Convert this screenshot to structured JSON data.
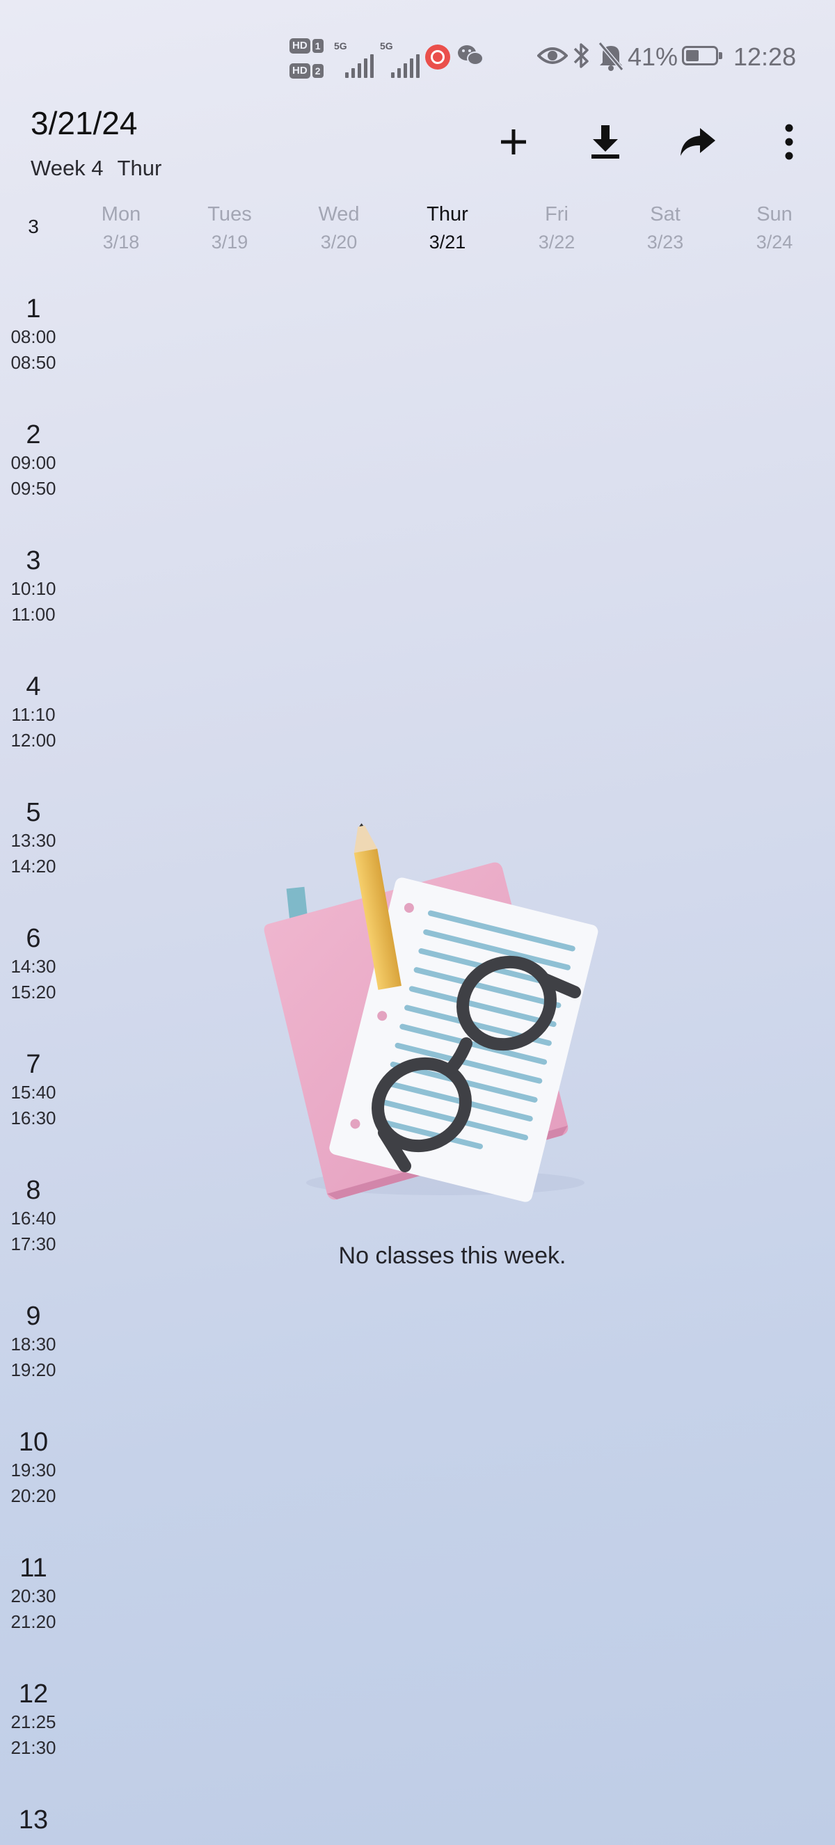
{
  "status_bar": {
    "sim1": {
      "hd": "HD",
      "num": "1"
    },
    "sim2": {
      "hd": "HD",
      "num": "2"
    },
    "net1": "5G",
    "net2": "5G",
    "battery_percent": "41%",
    "time": "12:28",
    "icons": [
      "eye-icon",
      "bluetooth-icon",
      "mute-bell-icon",
      "battery-icon",
      "app-notification-icon",
      "wechat-icon"
    ]
  },
  "header": {
    "date": "3/21/24",
    "week": "Week 4",
    "weekday": "Thur",
    "actions": [
      "add-icon",
      "download-icon",
      "share-icon",
      "more-icon"
    ]
  },
  "week_grid": {
    "month": "3",
    "days": [
      {
        "name": "Mon",
        "date": "3/18",
        "today": false
      },
      {
        "name": "Tues",
        "date": "3/19",
        "today": false
      },
      {
        "name": "Wed",
        "date": "3/20",
        "today": false
      },
      {
        "name": "Thur",
        "date": "3/21",
        "today": true
      },
      {
        "name": "Fri",
        "date": "3/22",
        "today": false
      },
      {
        "name": "Sat",
        "date": "3/23",
        "today": false
      },
      {
        "name": "Sun",
        "date": "3/24",
        "today": false
      }
    ],
    "periods": [
      {
        "num": "1",
        "start": "08:00",
        "end": "08:50"
      },
      {
        "num": "2",
        "start": "09:00",
        "end": "09:50"
      },
      {
        "num": "3",
        "start": "10:10",
        "end": "11:00"
      },
      {
        "num": "4",
        "start": "11:10",
        "end": "12:00"
      },
      {
        "num": "5",
        "start": "13:30",
        "end": "14:20"
      },
      {
        "num": "6",
        "start": "14:30",
        "end": "15:20"
      },
      {
        "num": "7",
        "start": "15:40",
        "end": "16:30"
      },
      {
        "num": "8",
        "start": "16:40",
        "end": "17:30"
      },
      {
        "num": "9",
        "start": "18:30",
        "end": "19:20"
      },
      {
        "num": "10",
        "start": "19:30",
        "end": "20:20"
      },
      {
        "num": "11",
        "start": "20:30",
        "end": "21:20"
      },
      {
        "num": "12",
        "start": "21:25",
        "end": "21:30"
      },
      {
        "num": "13",
        "start": "",
        "end": ""
      }
    ]
  },
  "empty_state": {
    "message": "No classes this week."
  },
  "colors": {
    "accent_pink": "#e7a8c6",
    "paper_lines": "#8fc0d4",
    "today_text": "#101014",
    "dim_text": "#a3a6b4"
  }
}
